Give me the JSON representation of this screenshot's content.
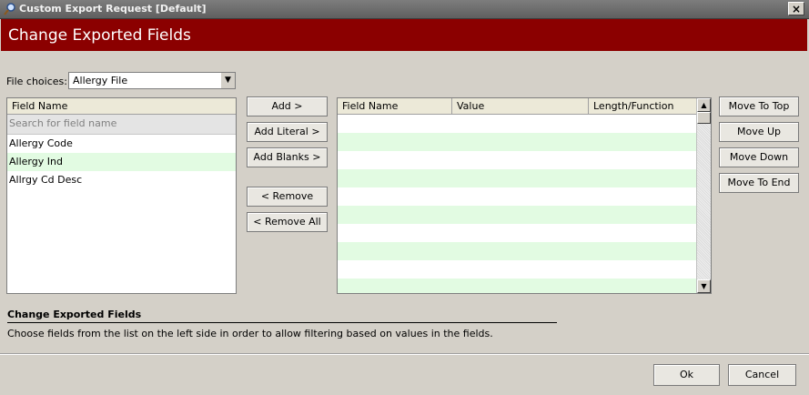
{
  "window": {
    "title": "Custom Export Request [Default]",
    "close_label": "×"
  },
  "header": {
    "title": "Change Exported Fields"
  },
  "file_choices": {
    "label": "File choices:",
    "value": "Allergy File"
  },
  "left_list": {
    "column_header": "Field Name",
    "search_placeholder": "Search for field name",
    "items": [
      "Allergy Code",
      "Allergy Ind",
      "Allrgy Cd Desc"
    ]
  },
  "buttons": {
    "add": "Add >",
    "add_literal": "Add Literal >",
    "add_blanks": "Add Blanks >",
    "remove": "< Remove",
    "remove_all": "< Remove All",
    "move_top": "Move To Top",
    "move_up": "Move Up",
    "move_down": "Move Down",
    "move_end": "Move To End",
    "ok": "Ok",
    "cancel": "Cancel"
  },
  "grid": {
    "columns": [
      "Field Name",
      "Value",
      "Length/Function"
    ]
  },
  "help": {
    "title": "Change Exported Fields",
    "text": "Choose fields from the list on the left side in order to allow filtering based on values in the fields."
  },
  "colors": {
    "header_bg": "#8b0000",
    "alt_row": "#e2fbe2",
    "window_bg": "#d4d0c8"
  }
}
